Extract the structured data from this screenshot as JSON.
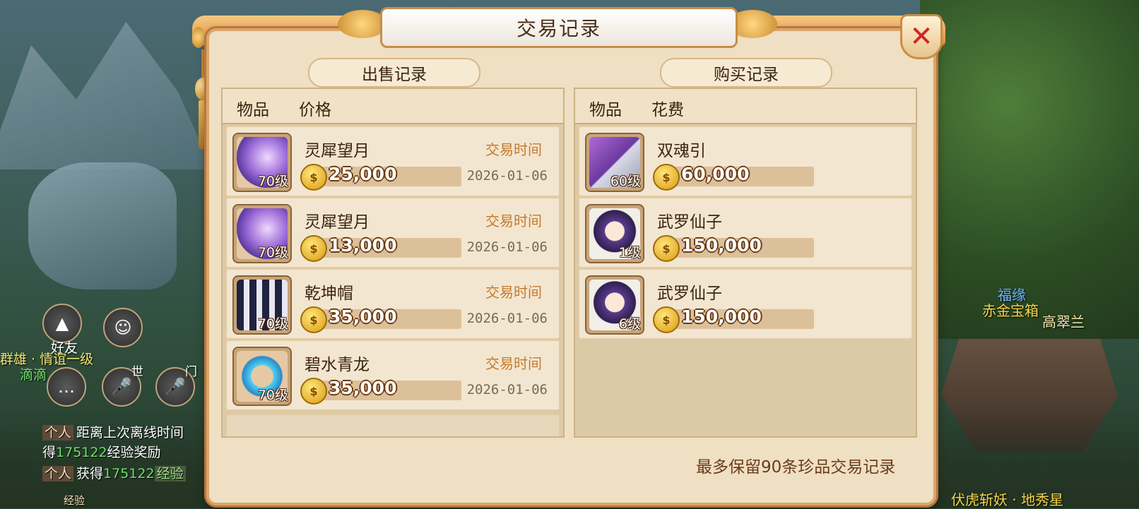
{
  "dialog": {
    "title": "交易记录",
    "close_label": "✕",
    "footer_note": "最多保留90条珍品交易记录"
  },
  "sell": {
    "section_title": "出售记录",
    "col_item": "物品",
    "col_price": "价格",
    "time_label": "交易时间",
    "rows": [
      {
        "name": "灵犀望月",
        "price": "25,000",
        "level": "70级",
        "date": "2026-01-06",
        "icon": "bow-icon"
      },
      {
        "name": "灵犀望月",
        "price": "13,000",
        "level": "70级",
        "date": "2026-01-06",
        "icon": "bow-icon"
      },
      {
        "name": "乾坤帽",
        "price": "35,000",
        "level": "70级",
        "date": "2026-01-06",
        "icon": "hat-icon"
      },
      {
        "name": "碧水青龙",
        "price": "35,000",
        "level": "70级",
        "date": "2026-01-06",
        "icon": "dragon-ring-icon"
      }
    ]
  },
  "buy": {
    "section_title": "购买记录",
    "col_item": "物品",
    "col_cost": "花费",
    "rows": [
      {
        "name": "双魂引",
        "price": "60,000",
        "level": "60级",
        "icon": "whip-icon"
      },
      {
        "name": "武罗仙子",
        "price": "150,000",
        "level": "1级",
        "icon": "fairy-pet-icon"
      },
      {
        "name": "武罗仙子",
        "price": "150,000",
        "level": "6级",
        "icon": "fairy-pet-icon"
      }
    ]
  },
  "hud": {
    "friend_label": "好友",
    "guild_text": "群雄 · 情谊一级",
    "player_name": "滴滴",
    "world_label": "世",
    "team_label": "门",
    "chat_tag": "个人",
    "chat_line1": "距离上次离线时间",
    "chat_line2_prefix": "得",
    "chat_line2_num": "175122",
    "chat_line2_suffix": "经验奖励",
    "chat_line3_prefix": "获得",
    "chat_line3_num": "175122",
    "chat_line3_badge": "经验",
    "exp_label": "经验"
  },
  "npcs": {
    "fuyuan": "福缘",
    "chest": "赤金宝箱",
    "npc_name": "高翠兰",
    "bottom_npc": "伏虎斩妖 · 地秀星"
  },
  "colors": {
    "panel_bg": "#efdfc3",
    "accent_orange": "#c37a2f",
    "close_red": "#d42424"
  }
}
